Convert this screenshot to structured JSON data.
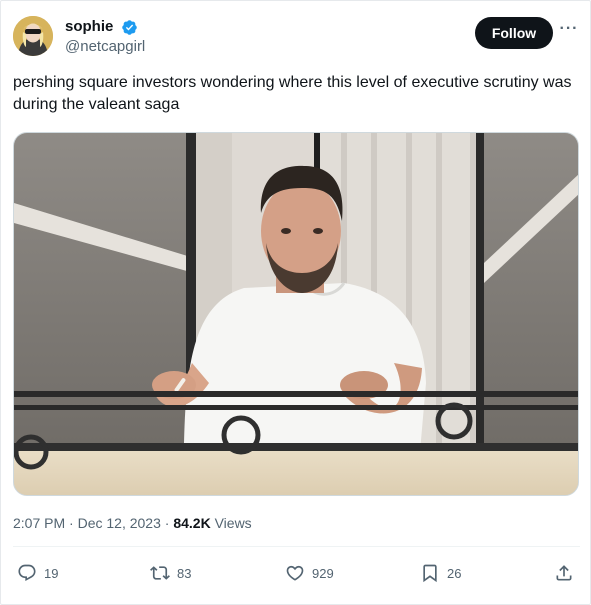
{
  "author": {
    "display_name": "sophie",
    "handle": "@netcapgirl",
    "verified": true
  },
  "header": {
    "follow_label": "Follow",
    "more_label": "···"
  },
  "tweet": {
    "text": "pershing square investors wondering where this level of executive scrutiny was during the valeant saga"
  },
  "meta": {
    "time": "2:07 PM",
    "separator": "·",
    "date": "Dec 12, 2023",
    "views_count": "84.2K",
    "views_label": "Views"
  },
  "actions": {
    "replies": "19",
    "reposts": "83",
    "likes": "929",
    "bookmarks": "26"
  },
  "icons": {
    "verified": "verified-badge-icon",
    "reply": "reply-icon",
    "repost": "repost-icon",
    "like": "heart-icon",
    "bookmark": "bookmark-icon",
    "share": "share-icon"
  },
  "colors": {
    "text_primary": "#0f1419",
    "text_secondary": "#536471",
    "verified_blue": "#1d9bf0",
    "follow_button": "#0f1419"
  }
}
